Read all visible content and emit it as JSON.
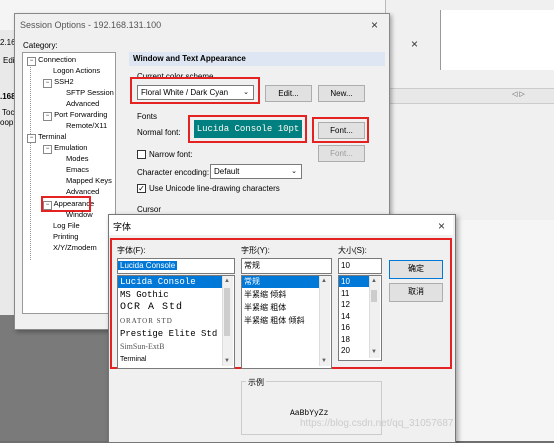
{
  "background_app": {
    "left_fragments": [
      "2.16",
      "Edi",
      ".168",
      "Toc",
      "oop"
    ],
    "right_arrows": "◁ ▷"
  },
  "session_window": {
    "title": "Session Options - 192.168.131.100",
    "close": "×",
    "category_label": "Category:",
    "tree": [
      {
        "label": "Connection",
        "toggle": "−"
      },
      {
        "label": "Logon Actions"
      },
      {
        "label": "SSH2",
        "toggle": "−"
      },
      {
        "label": "SFTP Session"
      },
      {
        "label": "Advanced"
      },
      {
        "label": "Port Forwarding",
        "toggle": "−"
      },
      {
        "label": "Remote/X11"
      },
      {
        "label": "Terminal",
        "toggle": "−"
      },
      {
        "label": "Emulation",
        "toggle": "−"
      },
      {
        "label": "Modes"
      },
      {
        "label": "Emacs"
      },
      {
        "label": "Mapped Keys"
      },
      {
        "label": "Advanced"
      },
      {
        "label": "Appearance",
        "toggle": "−"
      },
      {
        "label": "Window"
      },
      {
        "label": "Log File"
      },
      {
        "label": "Printing"
      },
      {
        "label": "X/Y/Zmodem"
      }
    ],
    "section_header": "Window and Text Appearance",
    "color_scheme_label": "Current color scheme",
    "color_scheme_value": "Floral White / Dark Cyan",
    "edit_button": "Edit...",
    "new_button": "New...",
    "fonts_label": "Fonts",
    "normal_font_label": "Normal font:",
    "normal_font_preview": "Lucida Console 10pt",
    "font_button": "Font...",
    "narrow_font_label": "Narrow font:",
    "narrow_font_button": "Font...",
    "encoding_label": "Character encoding:",
    "encoding_value": "Default",
    "unicode_label": "Use Unicode line-drawing characters",
    "unicode_checked": true,
    "cursor_label": "Cursor"
  },
  "font_dialog": {
    "title": "字体",
    "close": "×",
    "font_label": "字体(F):",
    "font_value": "Lucida Console",
    "fonts": [
      "Lucida Console",
      "MS Gothic",
      "OCR A Std",
      "ORATOR STD",
      "Prestige Elite Std",
      "SimSun-ExtB",
      "Terminal"
    ],
    "style_label": "字形(Y):",
    "style_value": "常规",
    "styles": [
      "常规",
      "半紧缩 倾斜",
      "半紧缩 粗体",
      "半紧缩 粗体 倾斜"
    ],
    "size_label": "大小(S):",
    "size_value": "10",
    "sizes": [
      "10",
      "11",
      "12",
      "14",
      "16",
      "18",
      "20"
    ],
    "ok_button": "确定",
    "cancel_button": "取消",
    "sample_label": "示例",
    "sample_text": "AaBbYyZz",
    "watermark": "https://blog.csdn.net/qq_31057687"
  },
  "colors": {
    "highlight": "#e52222",
    "selection": "#0078d7",
    "preview_bg": "#008080"
  }
}
